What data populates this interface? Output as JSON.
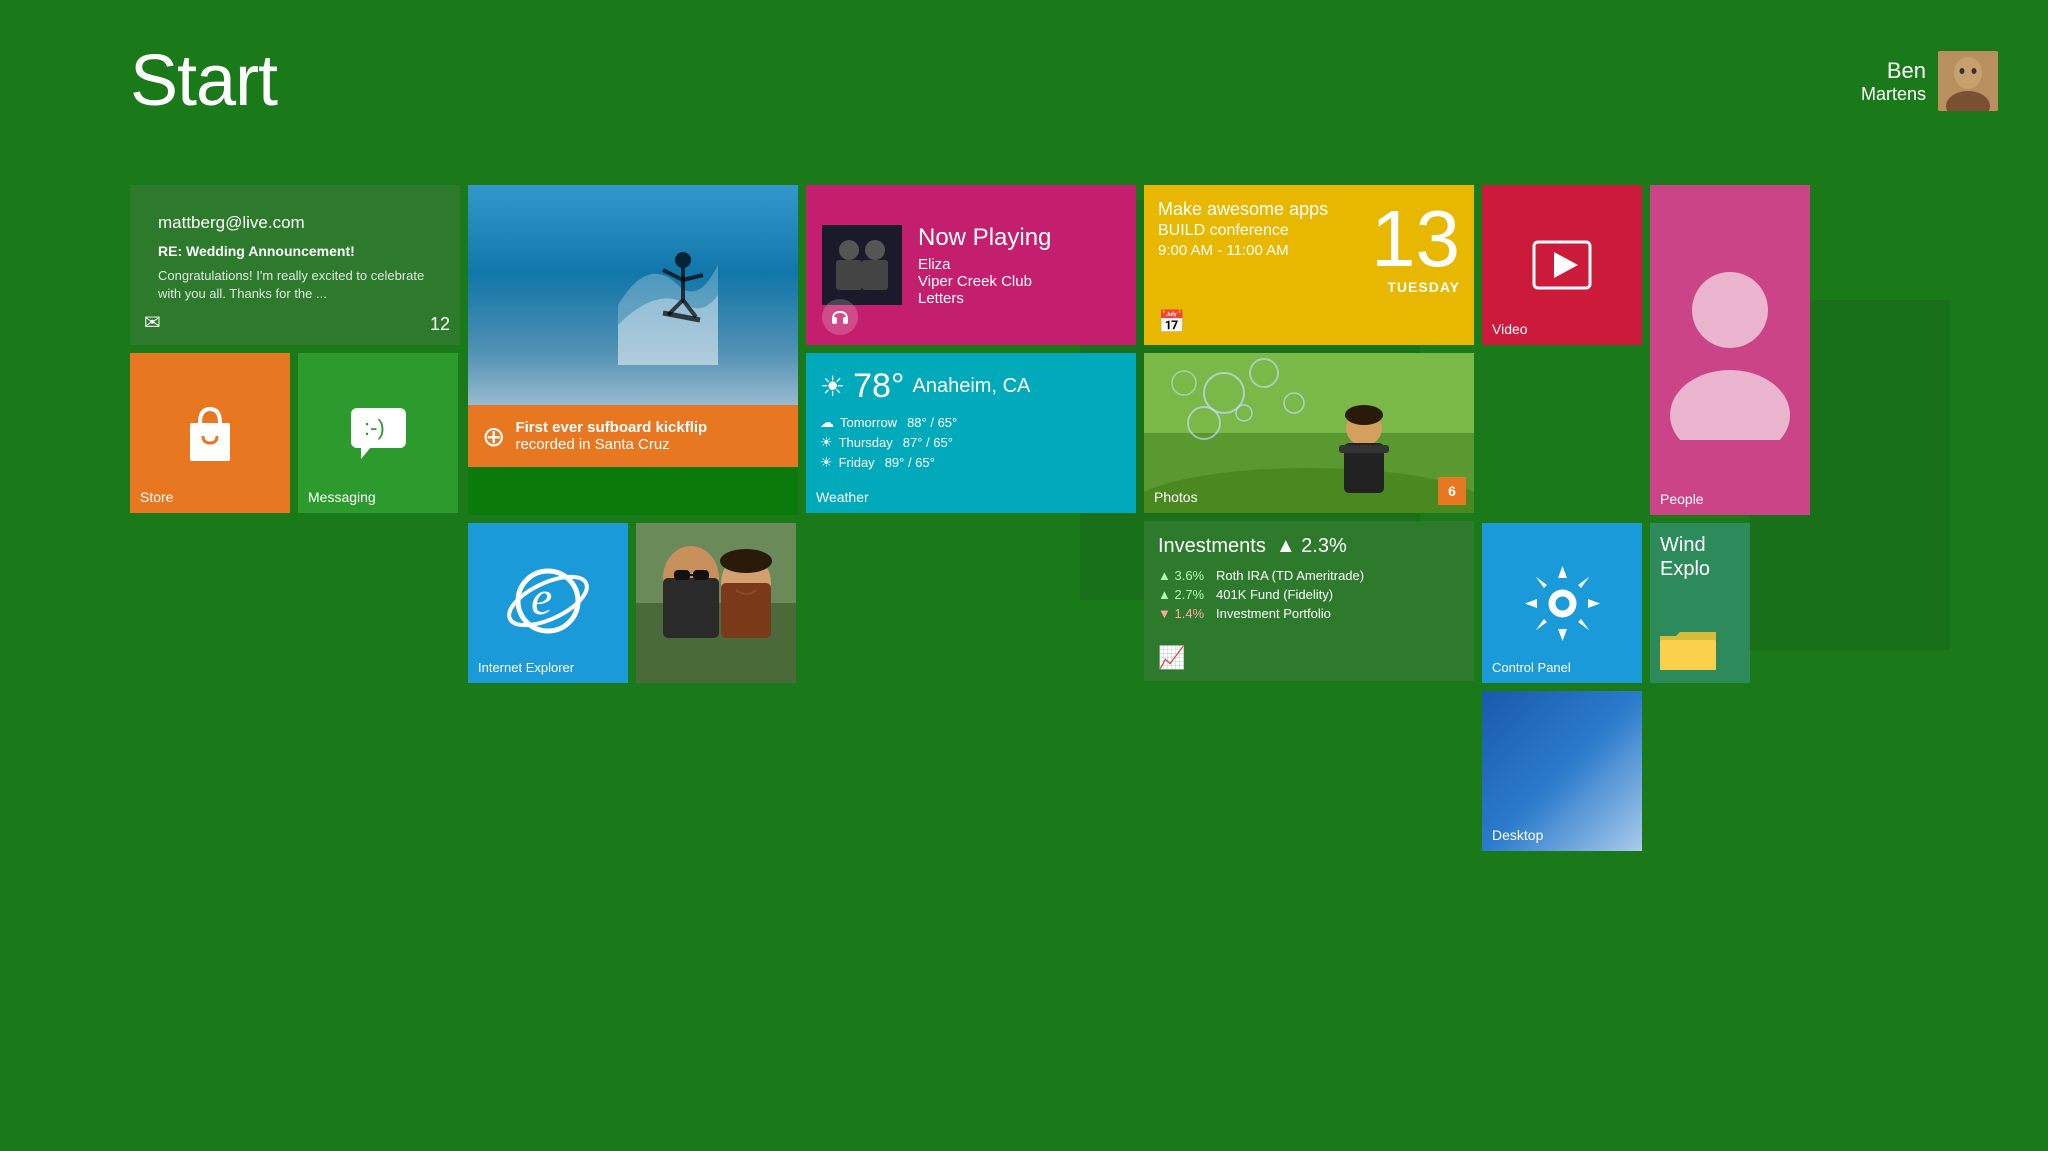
{
  "header": {
    "title": "Start",
    "user": {
      "first_name": "Ben",
      "last_name": "Martens"
    }
  },
  "tiles": {
    "email": {
      "from": "mattberg@live.com",
      "subject": "RE: Wedding Announcement!",
      "preview": "Congratulations! I'm really excited to celebrate with you all. Thanks for the ...",
      "count": "12",
      "label": ""
    },
    "surf": {
      "rss_text_line1": "First ever sufboard kickflip",
      "rss_text_line2": "recorded in Santa Cruz"
    },
    "calendar": {
      "event": "Make awesome apps",
      "conference": "BUILD conference",
      "time": "9:00 AM - 11:00 AM",
      "day_number": "13",
      "day_name": "TUESDAY",
      "label": ""
    },
    "ie": {
      "label": "Internet Explorer"
    },
    "music": {
      "now_playing": "Now Playing",
      "track": "Eliza",
      "artist": "Viper Creek Club",
      "album": "Letters"
    },
    "photos": {
      "label": "Photos",
      "count": "6"
    },
    "store": {
      "label": "Store"
    },
    "messaging": {
      "label": "Messaging"
    },
    "weather": {
      "temp": "78°",
      "city": "Anaheim, CA",
      "tomorrow_label": "Tomorrow",
      "tomorrow_temp": "88° / 65°",
      "thursday_label": "Thursday",
      "thursday_temp": "87° / 65°",
      "friday_label": "Friday",
      "friday_temp": "89° / 65°",
      "label": "Weather"
    },
    "investments": {
      "title": "Investments",
      "change": "▲ 2.3%",
      "row1_pct": "▲ 3.6%",
      "row1_name": "Roth IRA (TD Ameritrade)",
      "row2_pct": "▲ 2.7%",
      "row2_name": "401K Fund (Fidelity)",
      "row3_pct": "▼ 1.4%",
      "row3_name": "Investment Portfolio"
    },
    "video": {
      "label": "Video"
    },
    "people": {
      "label": "People"
    },
    "control_panel": {
      "label": "Control Panel"
    },
    "windows_explorer": {
      "label": "Wind\nExplo"
    },
    "desktop": {
      "label": "Desktop"
    }
  },
  "colors": {
    "bg": "#1e7a1e",
    "email_tile": "#2d7a2d",
    "surf_rss": "#e87722",
    "calendar_tile": "#e8b800",
    "ie_tile": "#1a9ad9",
    "music_tile": "#c41e6e",
    "photos_tile_bg": "#557722",
    "store_tile": "#e87722",
    "messaging_tile": "#2d9a2d",
    "weather_tile": "#00aabb",
    "invest_tile": "#2d7a2d",
    "video_tile": "#cc1a3a",
    "people_tile": "#cc4488",
    "control_tile": "#1a9ad9",
    "explorer_tile": "#e8aa00",
    "desktop_tile": "#1a5aaa"
  }
}
